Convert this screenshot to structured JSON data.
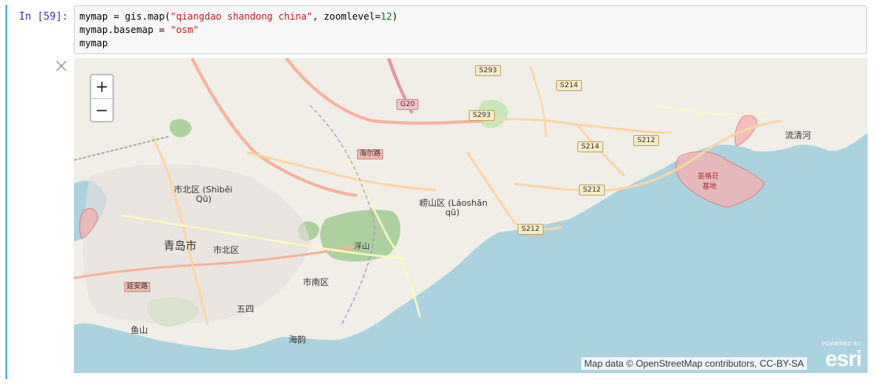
{
  "cell": {
    "prompt": "In [59]:",
    "code": {
      "l1_a": "mymap = gis.map(",
      "l1_str": "\"qiangdao shandong china\"",
      "l1_b": ", zoomlevel=",
      "l1_num": "12",
      "l1_c": ")",
      "l2_a": "mymap.basemap = ",
      "l2_str": "\"osm\"",
      "l3": "mymap"
    }
  },
  "map": {
    "zoom_in": "+",
    "zoom_out": "−",
    "attribution": "Map data © OpenStreetMap contributors, CC-BY-SA",
    "logo": {
      "powered_by": "POWERED BY",
      "wordmark": "esri"
    },
    "labels": {
      "qingdao": "青岛市",
      "shibei_1": "市北区 (Shìběi",
      "shibei_2": "Qū)",
      "shibei_cn": "市北区",
      "shinan": "市南区",
      "laoshan_1": "崂山区 (Láoshān",
      "laoshan_2": "qū)",
      "fushan": "浮山",
      "wusi": "五四",
      "yushan": "鱼山",
      "haiyun": "海韵",
      "liuqinghe": "流清河",
      "jiangge_1": "姜格荘",
      "jiangge_2": "基地"
    },
    "road_names": {
      "haier": "海尔路",
      "yanan": "延安路"
    },
    "shields": {
      "s293a": "S293",
      "s293b": "S293",
      "s214a": "S214",
      "s214b": "S214",
      "s212a": "S212",
      "s212b": "S212",
      "s212c": "S212",
      "g20": "G20"
    }
  }
}
